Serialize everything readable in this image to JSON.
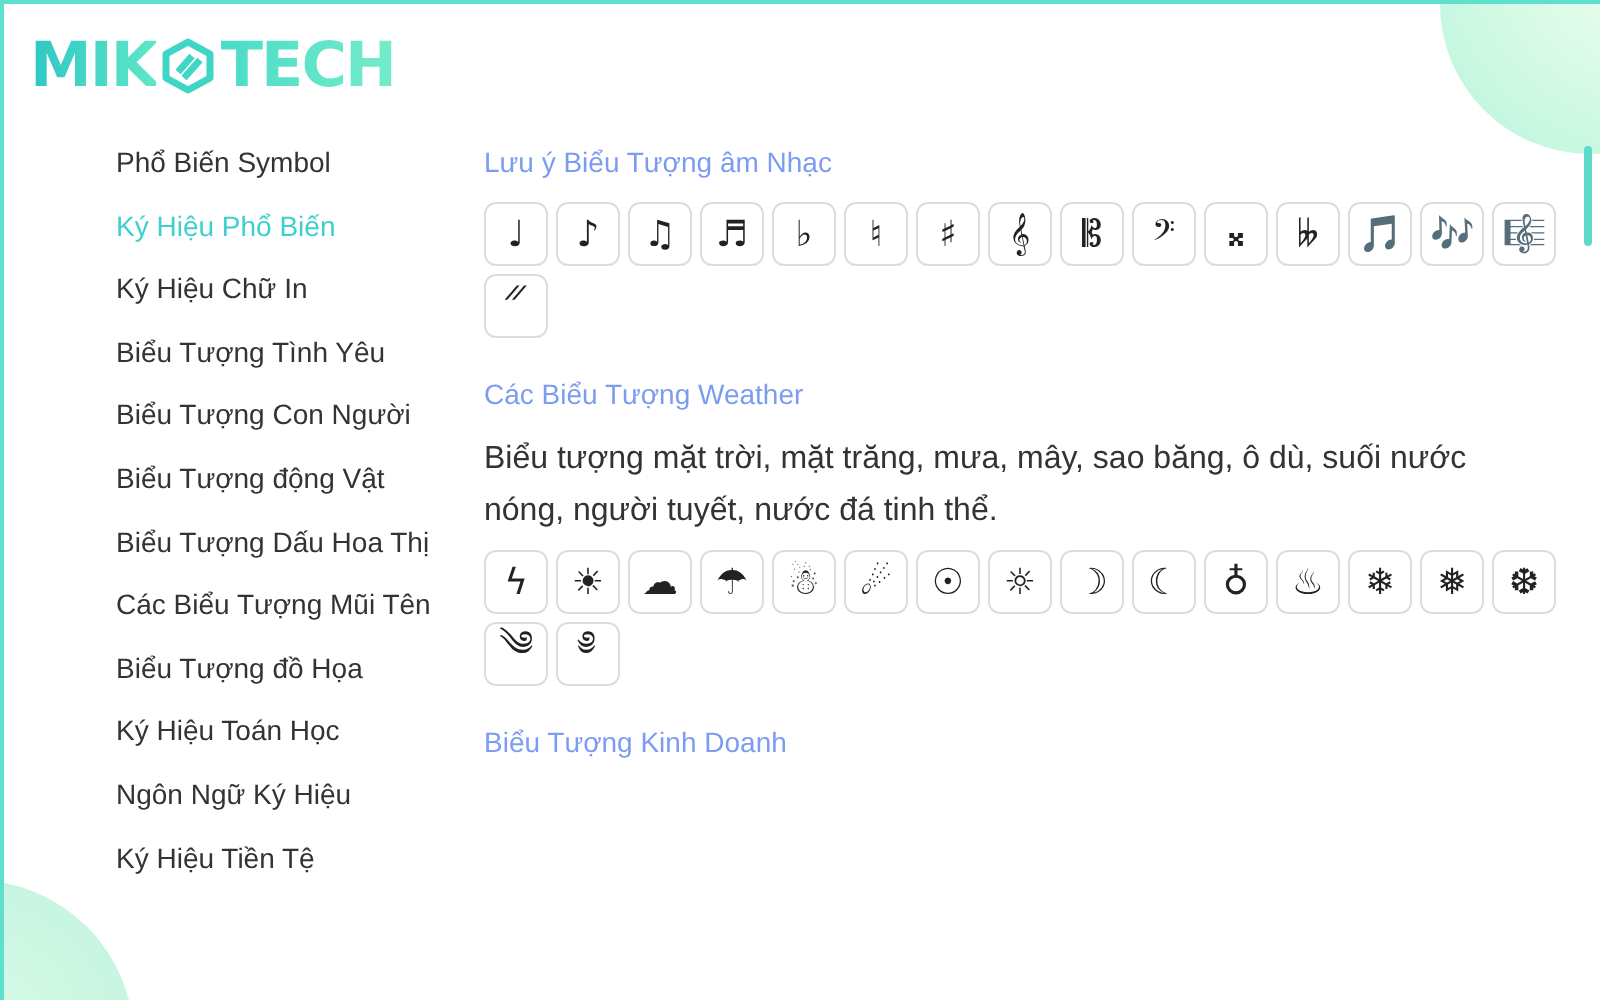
{
  "logo": {
    "left": "MIK",
    "right": "TECH"
  },
  "sidebar": {
    "items": [
      {
        "label": "Phổ Biến Symbol",
        "selected": false
      },
      {
        "label": "Ký Hiệu Phổ Biến",
        "selected": true
      },
      {
        "label": "Ký Hiệu Chữ In",
        "selected": false
      },
      {
        "label": "Biểu Tượng Tình Yêu",
        "selected": false
      },
      {
        "label": "Biểu Tượng Con Người",
        "selected": false
      },
      {
        "label": "Biểu Tượng động Vật",
        "selected": false
      },
      {
        "label": "Biểu Tượng Dấu Hoa Thị",
        "selected": false
      },
      {
        "label": "Các Biểu Tượng Mũi Tên",
        "selected": false
      },
      {
        "label": "Biểu Tượng đồ Họa",
        "selected": false
      },
      {
        "label": "Ký Hiệu Toán Học",
        "selected": false
      },
      {
        "label": "Ngôn Ngữ Ký Hiệu",
        "selected": false
      },
      {
        "label": "Ký Hiệu Tiền Tệ",
        "selected": false
      }
    ]
  },
  "sections": [
    {
      "title": "Lưu ý Biểu Tượng âm Nhạc",
      "symbols": [
        "♩",
        "♪",
        "♫",
        "♬",
        "♭",
        "♮",
        "♯",
        "𝄞",
        "𝄡",
        "𝄢",
        "𝄪",
        "𝄫",
        "🎵",
        "🎶",
        "🎼",
        "𝄓"
      ]
    },
    {
      "title": "Các Biểu Tượng Weather",
      "description": "Biểu tượng mặt trời, mặt trăng, mưa, mây, sao băng, ô dù, suối nước nóng, người tuyết, nước đá tinh thể.",
      "symbols": [
        "ϟ",
        "☀",
        "☁",
        "☂",
        "☃",
        "☄",
        "☉",
        "☼",
        "☽",
        "☾",
        "♁",
        "♨",
        "❄",
        "❅",
        "❆",
        "༄",
        "༅"
      ]
    },
    {
      "title": "Biểu Tượng Kinh Doanh"
    }
  ]
}
